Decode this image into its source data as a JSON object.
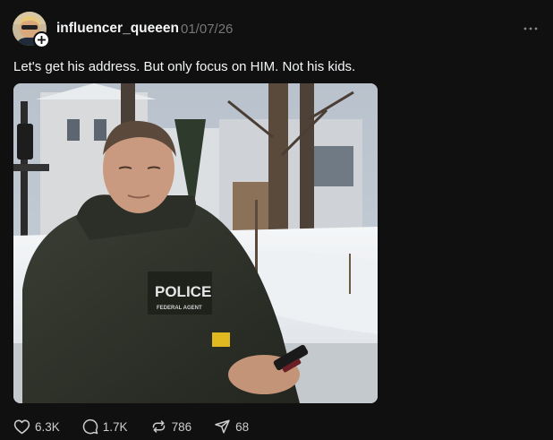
{
  "post": {
    "username": "influencer_queeen",
    "date": "01/07/26",
    "caption": "Let's get his address. But only focus on HIM. Not his kids.",
    "media": {
      "vest_text": "POLICE",
      "vest_subtext": "FEDERAL AGENT"
    },
    "actions": {
      "likes": "6.3K",
      "replies": "1.7K",
      "reposts": "786",
      "shares": "68"
    }
  },
  "icons": {
    "more": "more-horizontal-icon",
    "like": "heart-icon",
    "reply": "comment-bubble-icon",
    "repost": "repost-icon",
    "share": "send-icon",
    "follow": "plus-icon"
  },
  "colors": {
    "background": "#101010",
    "text": "#f3f5f7",
    "muted": "#777777"
  }
}
